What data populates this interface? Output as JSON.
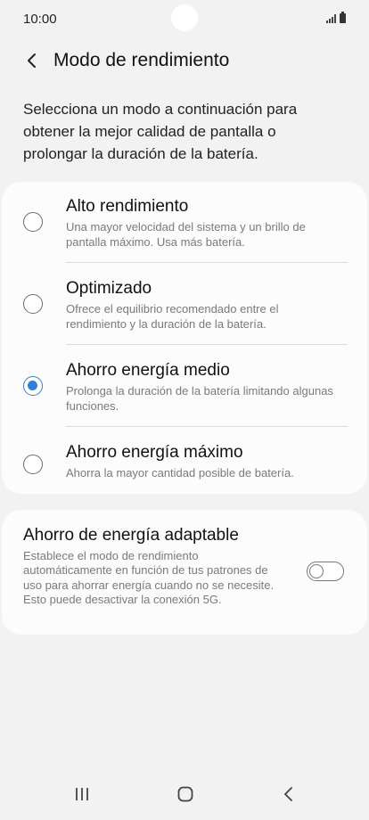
{
  "status_bar": {
    "time": "10:00"
  },
  "header": {
    "title": "Modo de rendimiento"
  },
  "description": "Selecciona un modo a continuación para obtener la mejor calidad de pantalla o prolongar la duración de la batería.",
  "modes": [
    {
      "title": "Alto rendimiento",
      "description": "Una mayor velocidad del sistema y un brillo de pantalla máximo. Usa más batería.",
      "selected": false
    },
    {
      "title": "Optimizado",
      "description": "Ofrece el equilibrio recomendado entre el rendimiento y la duración de la batería.",
      "selected": false
    },
    {
      "title": "Ahorro energía medio",
      "description": "Prolonga la duración de la batería limitando algunas funciones.",
      "selected": true
    },
    {
      "title": "Ahorro energía máximo",
      "description": "Ahorra la mayor cantidad posible de batería.",
      "selected": false
    }
  ],
  "adaptive": {
    "title": "Ahorro de energía adaptable",
    "description": "Establece el modo de rendimiento automáticamente en función de tus patrones de uso para ahorrar energía cuando no se necesite. Esto puede desactivar la conexión 5G.",
    "enabled": false
  },
  "colors": {
    "accent": "#2f7fe0",
    "background": "#f2f2f2",
    "card": "#fcfcfc",
    "secondary_text": "#7a7a7a"
  },
  "nav_bar": {
    "icons": [
      "recents-icon",
      "home-icon",
      "back-icon"
    ]
  }
}
